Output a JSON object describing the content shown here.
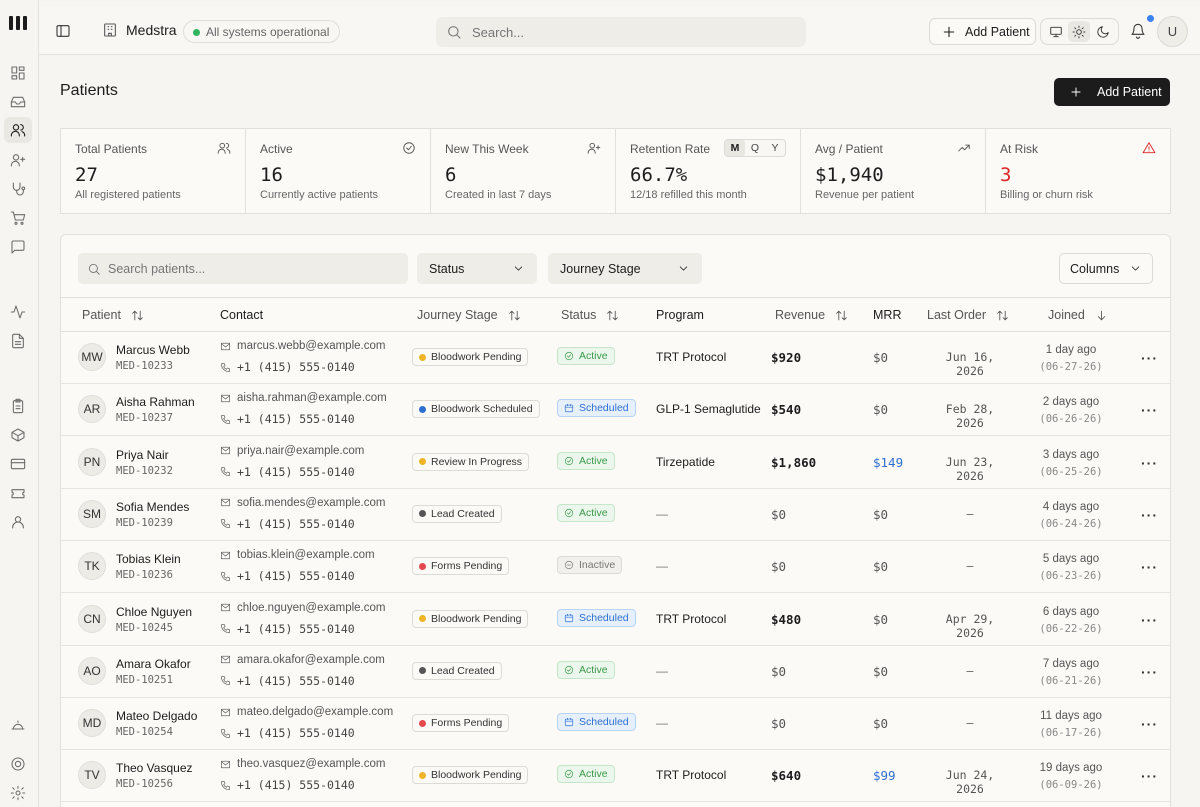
{
  "topbar": {
    "org_name": "Medstra",
    "status_text": "All systems operational",
    "search_placeholder": "Search...",
    "add_patient_label": "Add Patient",
    "user_initial": "U"
  },
  "page": {
    "title": "Patients",
    "add_patient_label": "Add Patient"
  },
  "stats": [
    {
      "label": "Total Patients",
      "value": "27",
      "sub": "All registered patients",
      "icon": "users-icon"
    },
    {
      "label": "Active",
      "value": "16",
      "sub": "Currently active patients",
      "icon": "check-circle-icon"
    },
    {
      "label": "New This Week",
      "value": "6",
      "sub": "Created in last 7 days",
      "icon": "user-plus-icon"
    },
    {
      "label": "Retention Rate",
      "value": "66.7%",
      "sub": "12/18 refilled this month",
      "periods": [
        "M",
        "Q",
        "Y"
      ],
      "selected_period": "M"
    },
    {
      "label": "Avg / Patient",
      "value": "$1,940",
      "sub": "Revenue per patient",
      "icon": "trending-up-icon"
    },
    {
      "label": "At Risk",
      "value": "3",
      "sub": "Billing or churn risk",
      "icon": "warning-icon"
    }
  ],
  "filters": {
    "search_placeholder": "Search patients...",
    "status_label": "Status",
    "journey_label": "Journey Stage",
    "columns_label": "Columns"
  },
  "columns": {
    "patient": "Patient",
    "contact": "Contact",
    "journey": "Journey Stage",
    "status": "Status",
    "program": "Program",
    "revenue": "Revenue",
    "mrr": "MRR",
    "last_order": "Last Order",
    "joined": "Joined"
  },
  "colors": {
    "stage_bloodwork_pending": "#f0b429",
    "stage_bloodwork_scheduled": "#2f6fd0",
    "stage_review": "#f0b429",
    "stage_lead": "#555555",
    "stage_forms": "#e5484d",
    "danger": "#dc2626",
    "accent_blue": "#2f6fd0"
  },
  "rows": [
    {
      "initials": "MW",
      "name": "Marcus Webb",
      "id": "MED-10233",
      "email": "marcus.webb@example.com",
      "phone": "+1 (415) 555-0140",
      "stage": "Bloodwork Pending",
      "stage_color": "#f0b429",
      "status": "Active",
      "status_kind": "active",
      "program": "TRT Protocol",
      "revenue": "$920",
      "mrr": "$0",
      "last_order": "Jun 16, 2026",
      "joined": "1 day ago",
      "joined_date": "(06-27-26)"
    },
    {
      "initials": "AR",
      "name": "Aisha Rahman",
      "id": "MED-10237",
      "email": "aisha.rahman@example.com",
      "phone": "+1 (415) 555-0140",
      "stage": "Bloodwork Scheduled",
      "stage_color": "#2f6fd0",
      "status": "Scheduled",
      "status_kind": "scheduled",
      "program": "GLP-1 Semaglutide",
      "revenue": "$540",
      "mrr": "$0",
      "last_order": "Feb 28, 2026",
      "joined": "2 days ago",
      "joined_date": "(06-26-26)"
    },
    {
      "initials": "PN",
      "name": "Priya Nair",
      "id": "MED-10232",
      "email": "priya.nair@example.com",
      "phone": "+1 (415) 555-0140",
      "stage": "Review In Progress",
      "stage_color": "#f0b429",
      "status": "Active",
      "status_kind": "active",
      "program": "Tirzepatide",
      "revenue": "$1,860",
      "mrr": "$149",
      "last_order": "Jun 23, 2026",
      "joined": "3 days ago",
      "joined_date": "(06-25-26)"
    },
    {
      "initials": "SM",
      "name": "Sofia Mendes",
      "id": "MED-10239",
      "email": "sofia.mendes@example.com",
      "phone": "+1 (415) 555-0140",
      "stage": "Lead Created",
      "stage_color": "#555555",
      "status": "Active",
      "status_kind": "active",
      "program": "—",
      "revenue": "$0",
      "mrr": "$0",
      "last_order": "–",
      "joined": "4 days ago",
      "joined_date": "(06-24-26)"
    },
    {
      "initials": "TK",
      "name": "Tobias Klein",
      "id": "MED-10236",
      "email": "tobias.klein@example.com",
      "phone": "+1 (415) 555-0140",
      "stage": "Forms Pending",
      "stage_color": "#e5484d",
      "status": "Inactive",
      "status_kind": "inactive",
      "program": "—",
      "revenue": "$0",
      "mrr": "$0",
      "last_order": "–",
      "joined": "5 days ago",
      "joined_date": "(06-23-26)"
    },
    {
      "initials": "CN",
      "name": "Chloe Nguyen",
      "id": "MED-10245",
      "email": "chloe.nguyen@example.com",
      "phone": "+1 (415) 555-0140",
      "stage": "Bloodwork Pending",
      "stage_color": "#f0b429",
      "status": "Scheduled",
      "status_kind": "scheduled",
      "program": "TRT Protocol",
      "revenue": "$480",
      "mrr": "$0",
      "last_order": "Apr 29, 2026",
      "joined": "6 days ago",
      "joined_date": "(06-22-26)"
    },
    {
      "initials": "AO",
      "name": "Amara Okafor",
      "id": "MED-10251",
      "email": "amara.okafor@example.com",
      "phone": "+1 (415) 555-0140",
      "stage": "Lead Created",
      "stage_color": "#555555",
      "status": "Active",
      "status_kind": "active",
      "program": "—",
      "revenue": "$0",
      "mrr": "$0",
      "last_order": "–",
      "joined": "7 days ago",
      "joined_date": "(06-21-26)"
    },
    {
      "initials": "MD",
      "name": "Mateo Delgado",
      "id": "MED-10254",
      "email": "mateo.delgado@example.com",
      "phone": "+1 (415) 555-0140",
      "stage": "Forms Pending",
      "stage_color": "#e5484d",
      "status": "Scheduled",
      "status_kind": "scheduled",
      "program": "—",
      "revenue": "$0",
      "mrr": "$0",
      "last_order": "–",
      "joined": "11 days ago",
      "joined_date": "(06-17-26)"
    },
    {
      "initials": "TV",
      "name": "Theo Vasquez",
      "id": "MED-10256",
      "email": "theo.vasquez@example.com",
      "phone": "+1 (415) 555-0140",
      "stage": "Bloodwork Pending",
      "stage_color": "#f0b429",
      "status": "Active",
      "status_kind": "active",
      "program": "TRT Protocol",
      "revenue": "$640",
      "mrr": "$99",
      "last_order": "Jun 24, 2026",
      "joined": "19 days ago",
      "joined_date": "(06-09-26)"
    }
  ]
}
